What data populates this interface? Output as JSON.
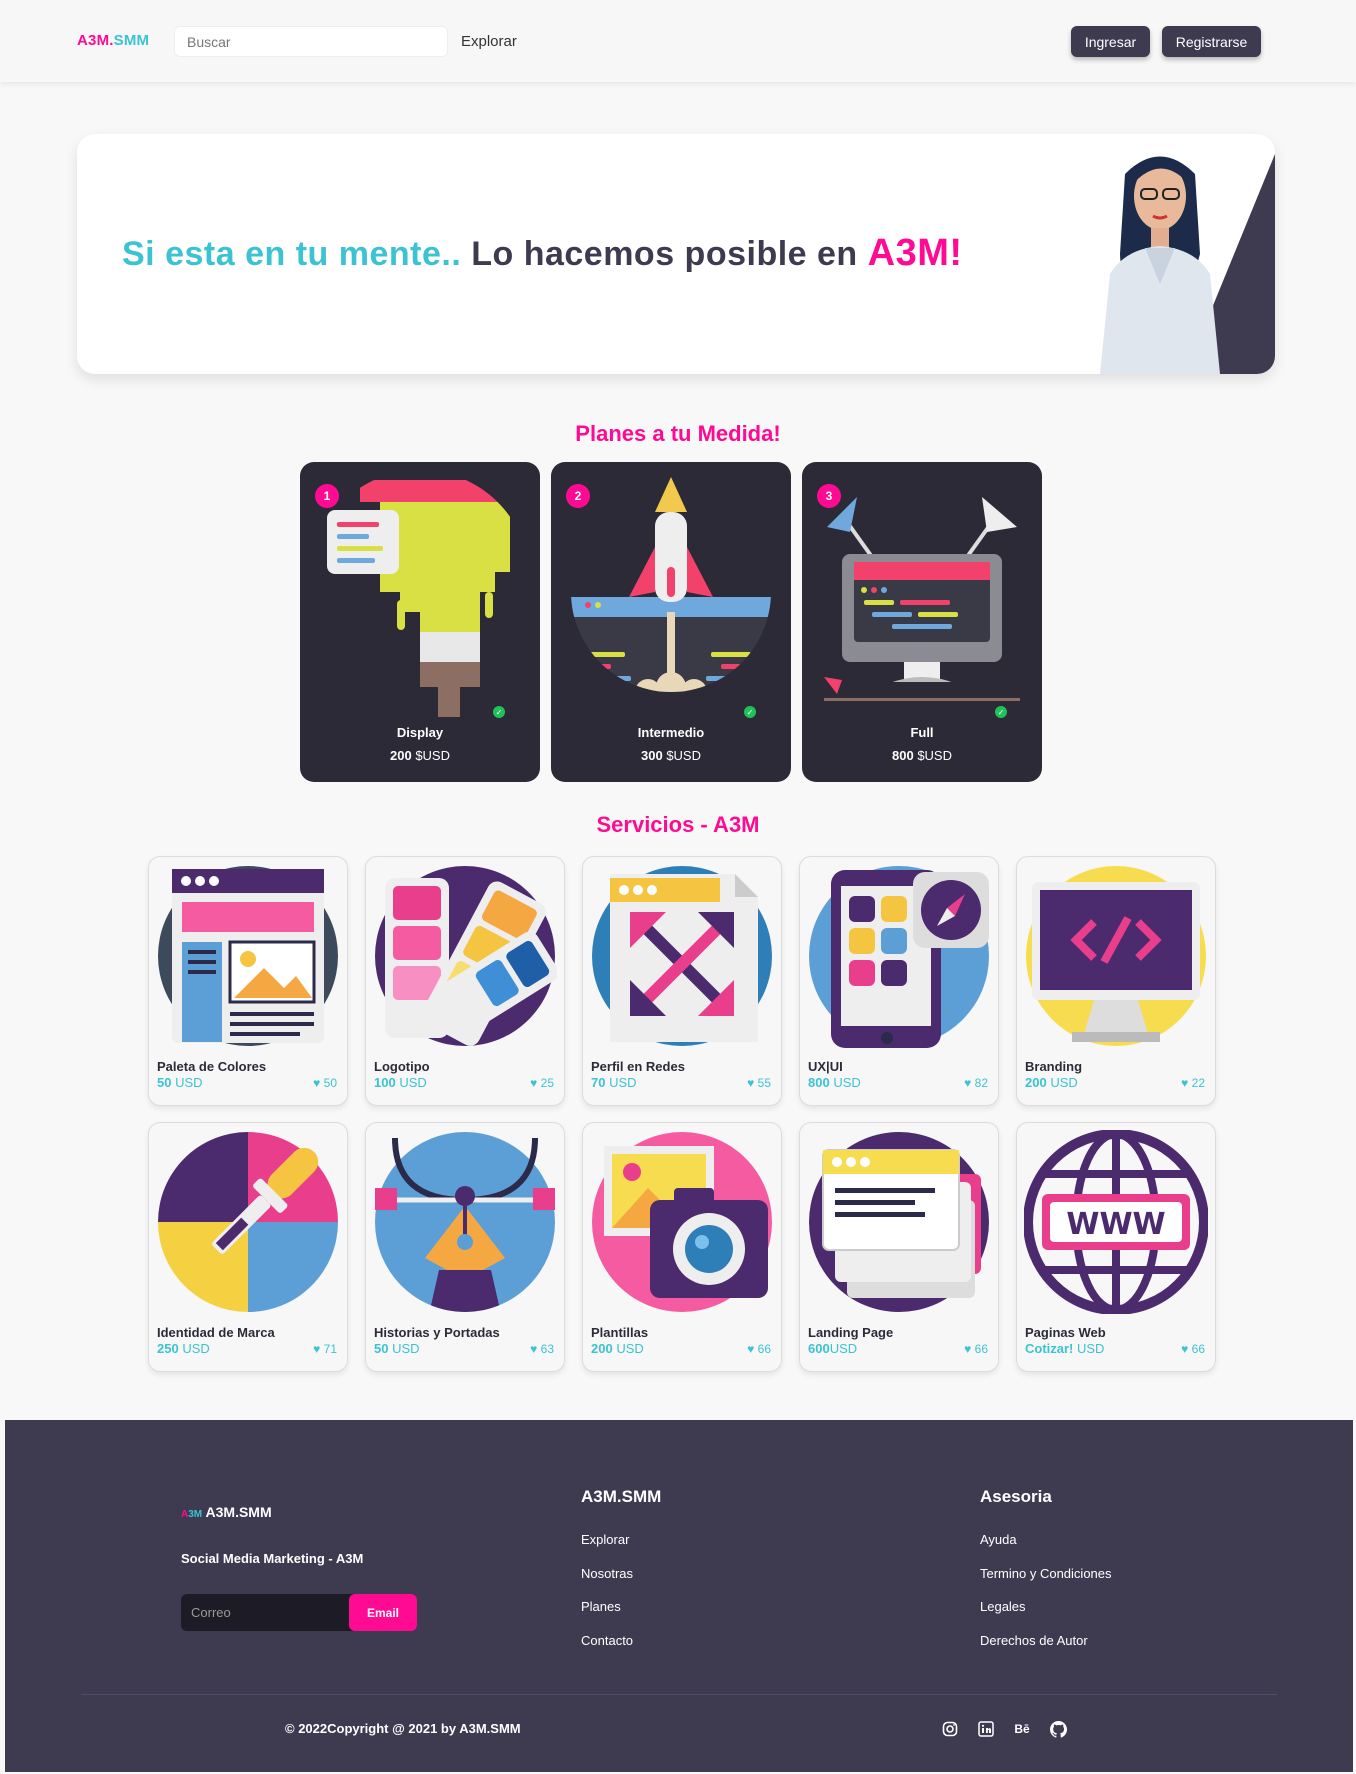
{
  "header": {
    "logo_part1": "A3M.",
    "logo_part2": "SMM",
    "search_placeholder": "Buscar",
    "explore": "Explorar",
    "login": "Ingresar",
    "register": "Registrarse"
  },
  "hero": {
    "part1": "Si esta en tu mente..",
    "part2": " Lo hacemos posible en ",
    "part3": "A3M!"
  },
  "plans_title": "Planes a tu Medida!",
  "plans": [
    {
      "num": "1",
      "name": "Display",
      "price": "200",
      "currency": "$USD"
    },
    {
      "num": "2",
      "name": "Intermedio",
      "price": "300",
      "currency": "$USD"
    },
    {
      "num": "3",
      "name": "Full",
      "price": "800",
      "currency": "$USD"
    }
  ],
  "services_title": "Servicios - A3M",
  "services": [
    {
      "name": "Paleta de Colores",
      "price": "50",
      "currency": " USD",
      "likes": "50"
    },
    {
      "name": "Logotipo",
      "price": "100",
      "currency": " USD",
      "likes": "25"
    },
    {
      "name": "Perfil en Redes",
      "price": "70",
      "currency": " USD",
      "likes": "55"
    },
    {
      "name": "UX|UI",
      "price": "800",
      "currency": " USD",
      "likes": "82"
    },
    {
      "name": "Branding",
      "price": "200",
      "currency": " USD",
      "likes": "22"
    },
    {
      "name": "Identidad de Marca",
      "price": "250",
      "currency": " USD",
      "likes": "71"
    },
    {
      "name": "Historias y Portadas",
      "price": "50",
      "currency": " USD",
      "likes": "63"
    },
    {
      "name": "Plantillas",
      "price": "200",
      "currency": " USD",
      "likes": "66"
    },
    {
      "name": "Landing Page",
      "price": "600",
      "currency": "USD",
      "likes": "66"
    },
    {
      "name": "Paginas Web",
      "price": "Cotizar!",
      "currency": " USD",
      "likes": "66"
    }
  ],
  "footer": {
    "logo_mini_a": "A",
    "logo_mini_b": "3M",
    "logo_text": " A3M.SMM",
    "tagline": "Social Media Marketing - A3M",
    "email_placeholder": "Correo",
    "email_button": "Email",
    "col1_title": "A3M.SMM",
    "col1_links": [
      "Explorar",
      "Nosotras",
      "Planes",
      "Contacto"
    ],
    "col2_title": "Asesoria",
    "col2_links": [
      "Ayuda",
      "Termino y Condiciones",
      "Legales",
      "Derechos de Autor"
    ],
    "copyright": "© 2022Copyright @ 2021 by A3M.SMM",
    "behance": "Bē"
  },
  "colors": {
    "accent_pink": "#ff0a93",
    "accent_teal": "#3bc3d4",
    "dark": "#3e3b51"
  },
  "icons": [
    "instagram-icon",
    "linkedin-icon",
    "behance-icon",
    "github-icon",
    "heart-icon",
    "check-icon"
  ]
}
